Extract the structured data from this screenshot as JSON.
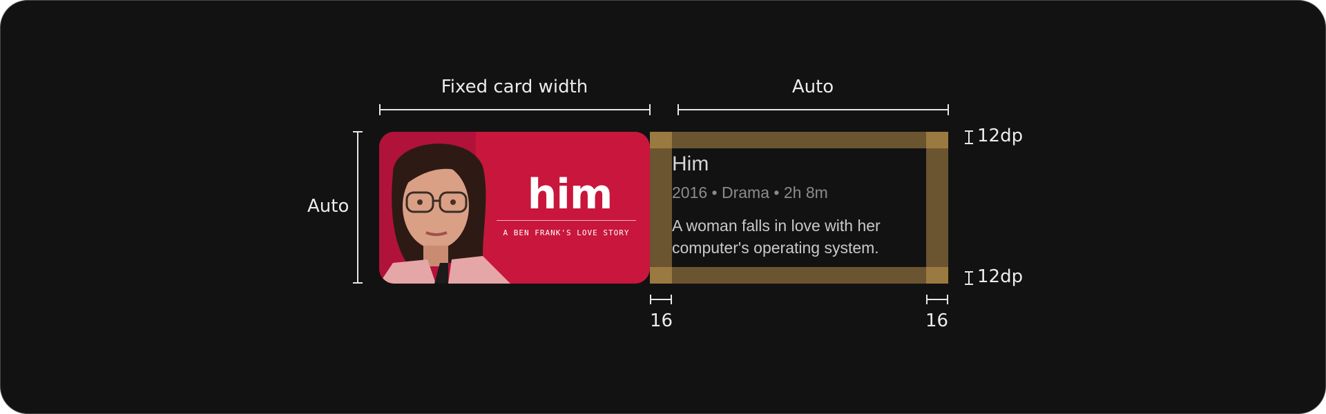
{
  "labels": {
    "fixed_card_width": "Fixed card width",
    "auto_top": "Auto",
    "auto_left": "Auto",
    "padding_top": "12dp",
    "padding_bottom": "12dp",
    "padding_left": "16",
    "padding_right": "16"
  },
  "poster": {
    "title": "him",
    "tagline": "A BEN FRANK'S LOVE STORY"
  },
  "movie": {
    "title": "Him",
    "meta": "2016 • Drama • 2h 8m",
    "description": "A woman falls in love with her computer's operating system."
  },
  "colors": {
    "background": "#121212",
    "poster_background": "#c8163c",
    "padding_highlight": "#6b5430",
    "padding_corner": "#9a7a40"
  }
}
